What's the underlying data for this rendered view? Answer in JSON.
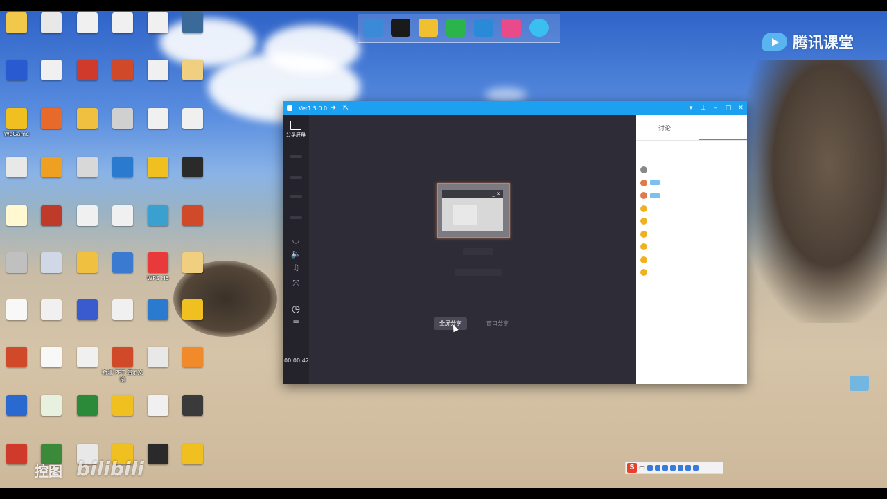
{
  "brand": {
    "name": "腾讯课堂",
    "accent": "#1ea0f0"
  },
  "desktop": {
    "icons": [
      {
        "label": "",
        "color": "#f2c84b"
      },
      {
        "label": "",
        "color": "#2a5ad0"
      },
      {
        "label": "WeGame",
        "color": "#f0c020"
      },
      {
        "label": "",
        "color": "#e8e8e8"
      },
      {
        "label": "",
        "color": "#fff8d0"
      },
      {
        "label": "",
        "color": "#c0c0c0"
      },
      {
        "label": "",
        "color": "#f8f8f8"
      },
      {
        "label": "",
        "color": "#d04a2a"
      },
      {
        "label": "",
        "color": "#2a6ad0"
      },
      {
        "label": "",
        "color": "#d03a2a"
      },
      {
        "label": "",
        "color": "#e8e8e8"
      },
      {
        "label": "",
        "color": "#f0f0f0"
      },
      {
        "label": "",
        "color": "#e86a2a"
      },
      {
        "label": "",
        "color": "#f0a020"
      },
      {
        "label": "",
        "color": "#c03a2a"
      },
      {
        "label": "",
        "color": "#d0d8e8"
      },
      {
        "label": "",
        "color": "#f0f0f0"
      },
      {
        "label": "",
        "color": "#f8f8f8"
      },
      {
        "label": "",
        "color": "#e8f0e0"
      },
      {
        "label": "",
        "color": "#3a8a3a"
      },
      {
        "label": "",
        "color": "#f0f0f0"
      },
      {
        "label": "",
        "color": "#d03a2a"
      },
      {
        "label": "",
        "color": "#f0c040"
      },
      {
        "label": "",
        "color": "#d8d8d8"
      },
      {
        "label": "",
        "color": "#f0f0f0"
      },
      {
        "label": "",
        "color": "#f0c040"
      },
      {
        "label": "",
        "color": "#3a5ad0"
      },
      {
        "label": "",
        "color": "#f0f0f0"
      },
      {
        "label": "",
        "color": "#2a8a3a"
      },
      {
        "label": "",
        "color": "#e8e8e8"
      },
      {
        "label": "",
        "color": "#f0f0f0"
      },
      {
        "label": "",
        "color": "#d04a2a"
      },
      {
        "label": "",
        "color": "#d0d0d0"
      },
      {
        "label": "",
        "color": "#2a7ad0"
      },
      {
        "label": "",
        "color": "#f0f0f0"
      },
      {
        "label": "",
        "color": "#3a7ad0"
      },
      {
        "label": "",
        "color": "#f0f0f0"
      },
      {
        "label": "新建 PPT 演示文稿",
        "color": "#d04a2a"
      },
      {
        "label": "",
        "color": "#f0c020"
      },
      {
        "label": "",
        "color": "#f0c020"
      },
      {
        "label": "",
        "color": "#f0f0f0"
      },
      {
        "label": "",
        "color": "#f0f0f0"
      },
      {
        "label": "",
        "color": "#f0f0f0"
      },
      {
        "label": "",
        "color": "#f0c020"
      },
      {
        "label": "",
        "color": "#3aa0d0"
      },
      {
        "label": "WPS H5",
        "color": "#e83a3a"
      },
      {
        "label": "",
        "color": "#2a7ad0"
      },
      {
        "label": "",
        "color": "#e8e8e8"
      },
      {
        "label": "",
        "color": "#f0f0f0"
      },
      {
        "label": "",
        "color": "#2a2a2a"
      },
      {
        "label": "",
        "color": "#3a6a9a"
      },
      {
        "label": "",
        "color": "#f0d080"
      },
      {
        "label": "",
        "color": "#f0f0f0"
      },
      {
        "label": "",
        "color": "#2a2a2a"
      },
      {
        "label": "",
        "color": "#d04a2a"
      },
      {
        "label": "",
        "color": "#f0d080"
      },
      {
        "label": "",
        "color": "#f0c020"
      },
      {
        "label": "",
        "color": "#f08a2a"
      },
      {
        "label": "",
        "color": "#3a3a3a"
      },
      {
        "label": "",
        "color": "#f0c020"
      },
      {
        "label": "",
        "color": "#f0f0f0"
      },
      {
        "label": "",
        "color": "#3a9ad0"
      },
      {
        "label": "",
        "color": "#f0c020"
      }
    ]
  },
  "window": {
    "title": "",
    "version": "Ver1.5.0.0",
    "rail": {
      "share_label": "分享屏幕",
      "timer": "00:00:42"
    }
  },
  "share": {
    "fullscreen_label": "全屏分享",
    "window_label": "窗口分享"
  },
  "chat": {
    "tab_discussion": "讨论",
    "tab_members": "",
    "search_placeholder": "",
    "members": [
      {
        "name": "",
        "avatar": "#888",
        "badge": false,
        "action": ""
      },
      {
        "name": "",
        "avatar": "#e07a4a",
        "badge": true,
        "action": ""
      },
      {
        "name": "",
        "avatar": "#e07a4a",
        "badge": true,
        "action": ""
      },
      {
        "name": "",
        "avatar": "#f0b020",
        "badge": false,
        "action": ""
      },
      {
        "name": "",
        "avatar": "#f0b020",
        "badge": false,
        "action": ""
      },
      {
        "name": "",
        "avatar": "#f0b020",
        "badge": false,
        "action": ""
      },
      {
        "name": "",
        "avatar": "#f0b020",
        "badge": false,
        "action": ""
      },
      {
        "name": "",
        "avatar": "#f0b020",
        "badge": false,
        "action": ""
      },
      {
        "name": "",
        "avatar": "#f0b020",
        "badge": false,
        "action": ""
      }
    ]
  },
  "ime": {
    "logo": "S",
    "mode": "中"
  },
  "watermark": {
    "left": "控图",
    "bilibili": "bilibili"
  }
}
